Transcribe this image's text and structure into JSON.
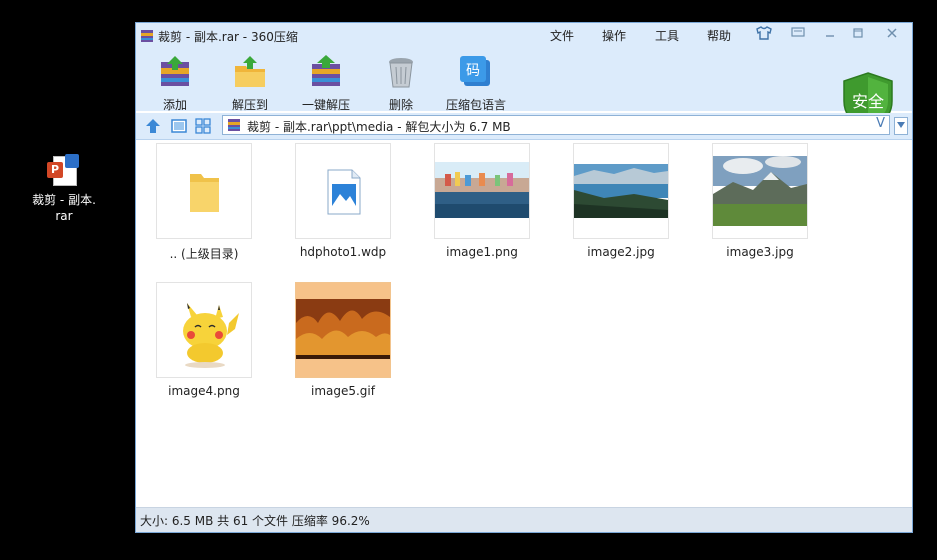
{
  "desktop": {
    "icon_label_line1": "裁剪 - 副本.",
    "icon_label_line2": "rar"
  },
  "window": {
    "title": "裁剪 - 副本.rar - 360压缩",
    "menu": [
      "文件",
      "操作",
      "工具",
      "帮助"
    ],
    "toolbar": [
      {
        "label": "添加"
      },
      {
        "label": "解压到"
      },
      {
        "label": "一键解压"
      },
      {
        "label": "删除"
      },
      {
        "label": "压缩包语言"
      }
    ],
    "tool_badge": "码",
    "safe_label": "安全",
    "address": "裁剪 - 副本.rar\\ppt\\media - 解包大小为 6.7 MB",
    "address_v": "V",
    "files": [
      {
        "name": ".. (上级目录)",
        "kind": "folder"
      },
      {
        "name": "hdphoto1.wdp",
        "kind": "wdp"
      },
      {
        "name": "image1.png",
        "kind": "photo-city"
      },
      {
        "name": "image2.jpg",
        "kind": "photo-lake"
      },
      {
        "name": "image3.jpg",
        "kind": "photo-mountain"
      },
      {
        "name": "image4.png",
        "kind": "photo-pikachu"
      },
      {
        "name": "image5.gif",
        "kind": "photo-fire"
      }
    ],
    "status": "大小: 6.5 MB 共 61 个文件 压缩率 96.2%"
  },
  "colors": {
    "chrome": "#dcebfb",
    "border": "#7aa7d6",
    "status": "#dde6f0",
    "safe_green": "#3f9a2e"
  }
}
